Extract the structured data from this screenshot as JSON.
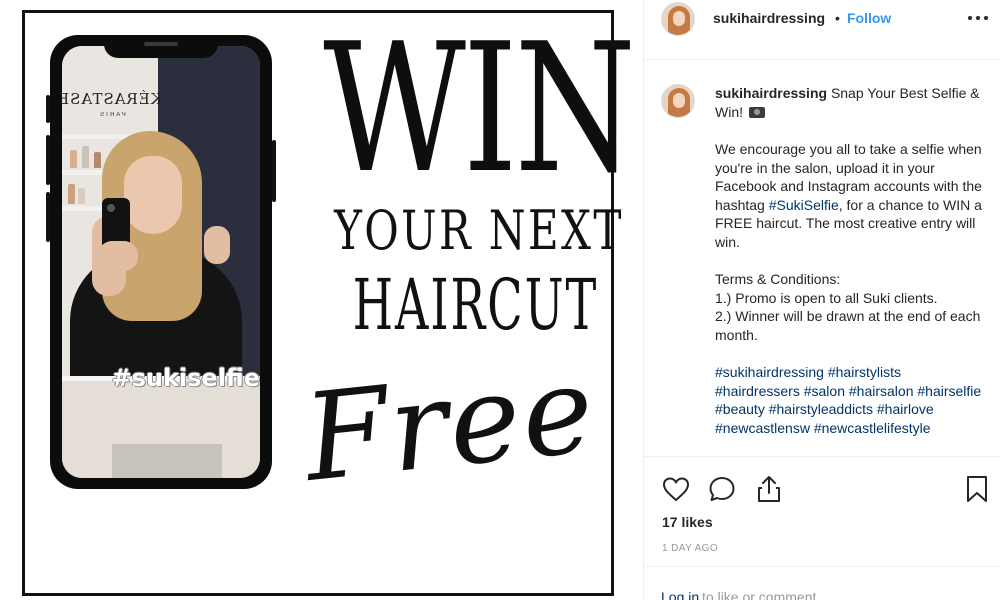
{
  "post": {
    "username": "sukihairdressing",
    "follow_label": "Follow",
    "header_separator": "•",
    "more_icon": "more-horizontal-icon"
  },
  "image": {
    "brand_sign": "KÉRASTASE",
    "brand_sub": "PARIS",
    "hashtag_overlay": "#sukiselfie",
    "headline_win": "WIN",
    "headline_line2": "YOUR NEXT",
    "headline_line3": "HAIRCUT",
    "headline_script": "Free"
  },
  "caption": {
    "username": "sukihairdressing",
    "title": "Snap Your Best Selfie & Win!",
    "body_before_tag": "We encourage you all to take a selfie when you're in the salon, upload it in your Facebook and Instagram accounts with the hashtag",
    "inline_tag": "#SukiSelfie",
    "body_after_tag": ", for a chance to WIN a FREE haircut. The most creative entry will win.",
    "terms_heading": "Terms & Conditions:",
    "term_1": "1.) Promo is open to all Suki clients.",
    "term_2": "2.) Winner will be drawn at the end of each month.",
    "hashtags": [
      "#sukihairdressing",
      "#hairstylists",
      "#hairdressers",
      "#salon",
      "#hairsalon",
      "#hairselfie",
      "#beauty",
      "#hairstyleaddicts",
      "#hairlove",
      "#newcastlensw",
      "#newcastlelifestyle"
    ]
  },
  "actions": {
    "like_icon": "heart-icon",
    "comment_icon": "comment-bubble-icon",
    "share_icon": "share-upload-icon",
    "save_icon": "bookmark-icon"
  },
  "stats": {
    "likes": "17 likes",
    "date": "1 DAY AGO"
  },
  "comment_row": {
    "login_link": "Log in",
    "login_rest": "to like or comment."
  },
  "colors": {
    "link_blue": "#3897f0",
    "hashtag_blue": "#003569",
    "text": "#262626",
    "muted": "#999999",
    "border": "#efefef"
  }
}
